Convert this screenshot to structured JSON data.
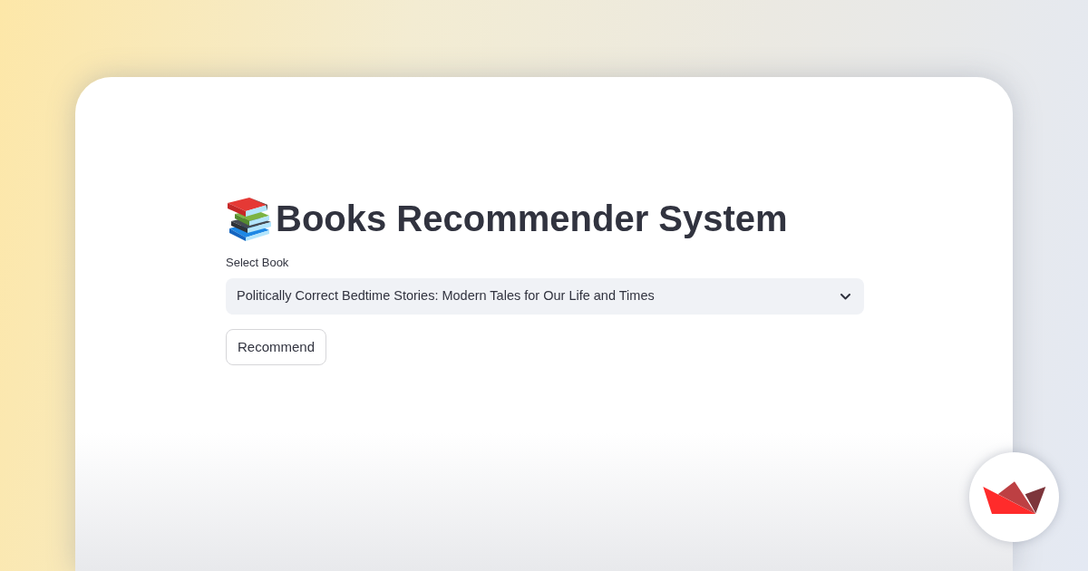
{
  "title": "Books Recommender System",
  "select": {
    "label": "Select Book",
    "value": "Politically Correct Bedtime Stories: Modern Tales for Our Life and Times"
  },
  "button": {
    "label": "Recommend"
  }
}
